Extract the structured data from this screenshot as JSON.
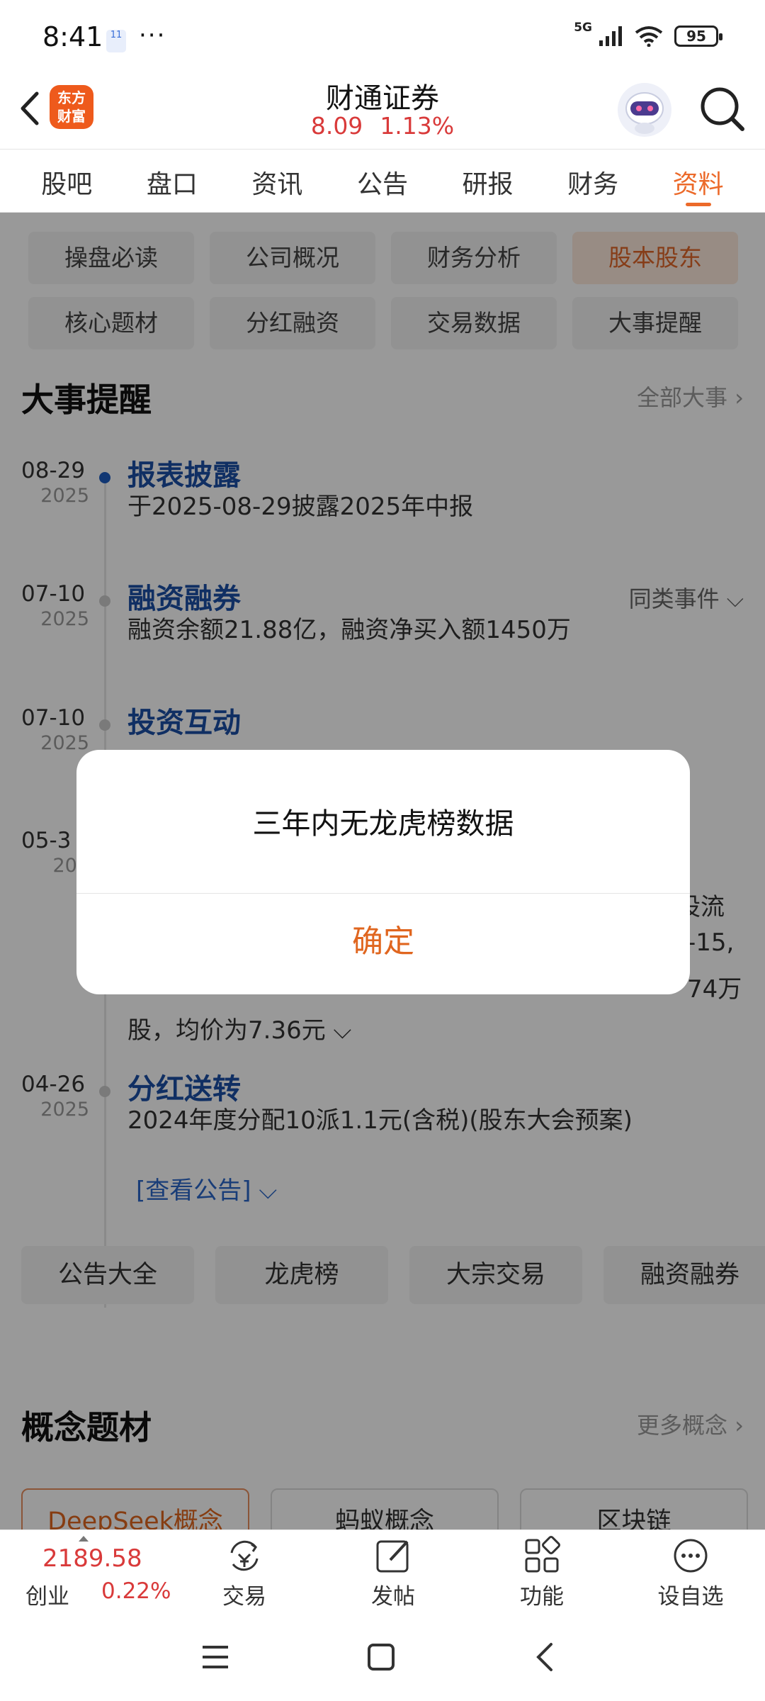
{
  "status_bar": {
    "time": "8:41",
    "notif_badge": "11",
    "dots": "···",
    "network": "5G",
    "battery": "95"
  },
  "header": {
    "logo_text_1": "东方",
    "logo_text_2": "财富",
    "stock_name": "财通证券",
    "price": "8.09",
    "change_pct": "1.13%",
    "price_color": "#d93a3a"
  },
  "tabs": [
    {
      "label": "股吧"
    },
    {
      "label": "盘口"
    },
    {
      "label": "资讯"
    },
    {
      "label": "公告"
    },
    {
      "label": "研报"
    },
    {
      "label": "财务"
    },
    {
      "label": "资料",
      "active": true
    }
  ],
  "sub_tabs": [
    {
      "label": "操盘必读"
    },
    {
      "label": "公司概况"
    },
    {
      "label": "财务分析"
    },
    {
      "label": "股本股东",
      "active": true
    },
    {
      "label": "核心题材"
    },
    {
      "label": "分红融资"
    },
    {
      "label": "交易数据"
    },
    {
      "label": "大事提醒"
    }
  ],
  "events_section": {
    "title": "大事提醒",
    "more": "全部大事 ›"
  },
  "events": [
    {
      "md": "08-29",
      "yr": "2025",
      "title": "报表披露",
      "desc": "于2025-08-29披露2025年中报"
    },
    {
      "md": "07-10",
      "yr": "2025",
      "title": "融资融券",
      "desc": "融资余额21.88亿，融资净买入额1450万",
      "similar": "同类事件 ⌵"
    },
    {
      "md": "07-10",
      "yr": "2025",
      "title": "投资互动",
      "desc": ""
    },
    {
      "md": "05-3",
      "yr": "202",
      "title": "",
      "desc": ""
    },
    {
      "md": "04-26",
      "yr": "2025",
      "title": "分红送转",
      "desc": "2024年度分配10派1.1元(含税)(股东大会预案)"
    }
  ],
  "obscured_lines": {
    "right_1": "设流",
    "right_2": "-15,",
    "right_3": "74万",
    "last": "股，均价为7.36元 ⌵"
  },
  "view_notice": "[查看公告] ⌵",
  "bottom_links": [
    {
      "label": "公告大全"
    },
    {
      "label": "龙虎榜"
    },
    {
      "label": "大宗交易"
    },
    {
      "label": "融资融券"
    }
  ],
  "concept_section": {
    "title": "概念题材",
    "more": "更多概念 ›"
  },
  "concept_tags": [
    {
      "label": "DeepSeek概念",
      "hot": true
    },
    {
      "label": "蚂蚁概念"
    },
    {
      "label": "区块链"
    }
  ],
  "bottom_bar": {
    "index_value": "2189.58",
    "index_name": "创业",
    "index_pct": "0.22%",
    "nav": [
      {
        "label": "交易",
        "icon": "yen-cycle-icon"
      },
      {
        "label": "发帖",
        "icon": "edit-icon"
      },
      {
        "label": "功能",
        "icon": "grid-icon"
      },
      {
        "label": "设自选",
        "icon": "more-icon"
      }
    ]
  },
  "dialog": {
    "message": "三年内无龙虎榜数据",
    "confirm": "确定",
    "accent": "#e0661f"
  }
}
